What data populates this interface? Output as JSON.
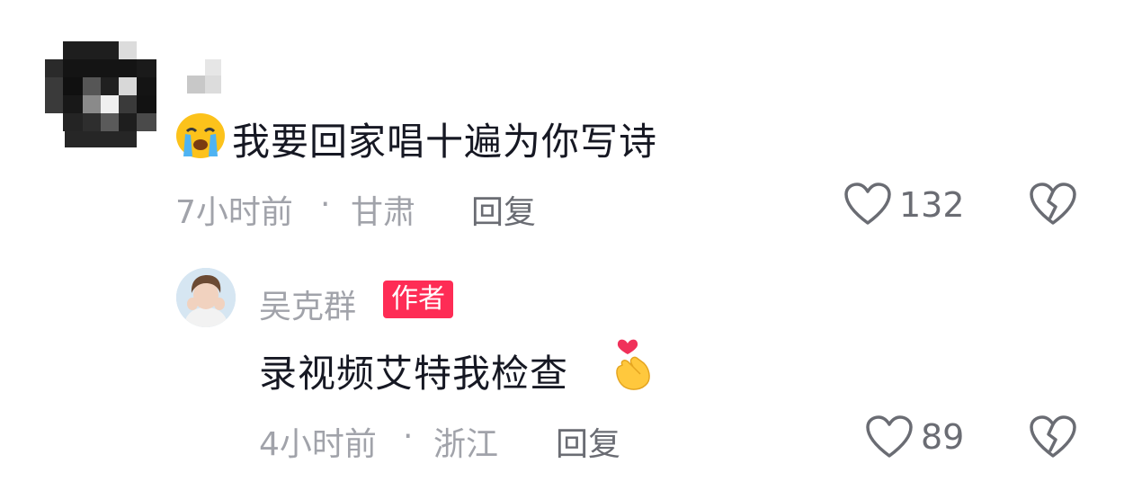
{
  "comments": [
    {
      "text": "我要回家唱十遍为你写诗",
      "leading_emoji": "loudly-crying-face-emoji",
      "time": "7小时前",
      "separator": "·",
      "location": "甘肃",
      "reply_label": "回复",
      "like_count": "132",
      "replies": [
        {
          "author": "吴克群",
          "author_badge": "作者",
          "text": "录视频艾特我检查",
          "trailing_emoji": "heart-hands-emoji",
          "time": "4小时前",
          "separator": "·",
          "location": "浙江",
          "reply_label": "回复",
          "like_count": "89"
        }
      ]
    }
  ],
  "colors": {
    "text_primary": "#161823",
    "text_secondary": "#a1a3aa",
    "badge": "#fe2c55"
  }
}
